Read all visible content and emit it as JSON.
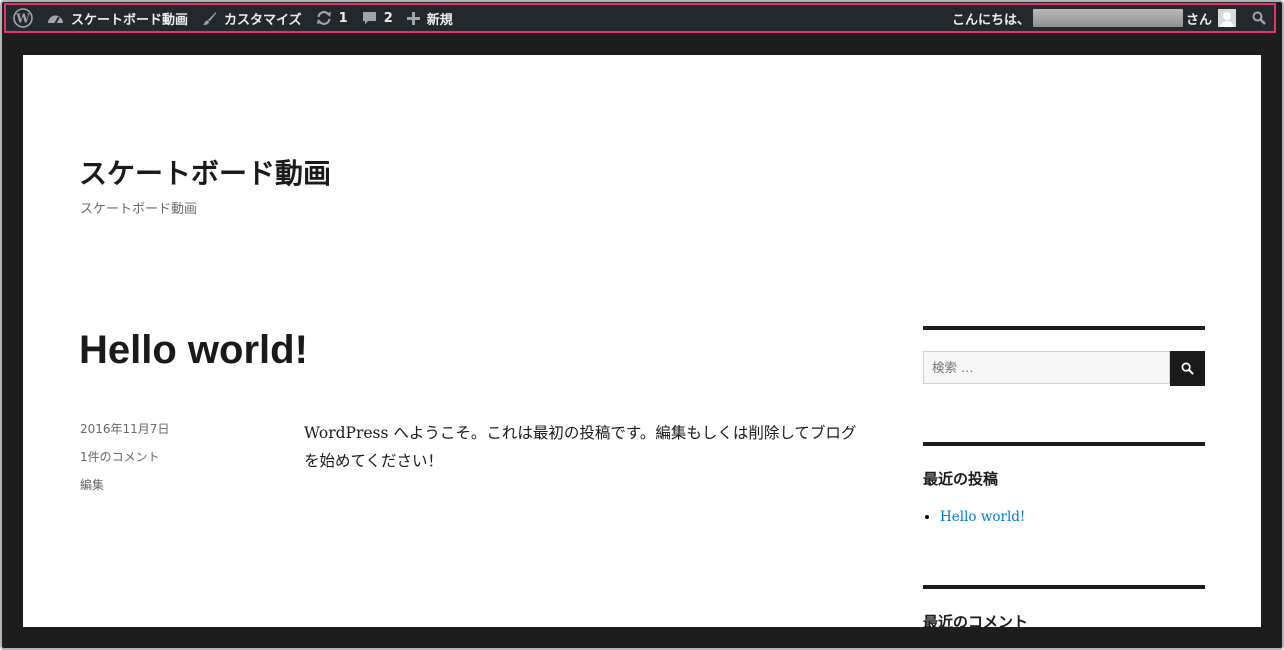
{
  "admin_bar": {
    "site_name": "スケートボード動画",
    "customize": "カスタマイズ",
    "updates_count": "1",
    "comments_count": "2",
    "new_label": "新規",
    "greeting": "こんにちは、",
    "honorific": "さん"
  },
  "site": {
    "title": "スケートボード動画",
    "description": "スケートボード動画"
  },
  "post": {
    "title": "Hello world!",
    "date": "2016年11月7日",
    "comments": "1件のコメント",
    "edit": "編集",
    "body": "WordPress へようこそ。これは最初の投稿です。編集もしくは削除してブログを始めてください！"
  },
  "sidebar": {
    "search_placeholder": "検索 …",
    "recent_posts_title": "最近の投稿",
    "recent_posts": [
      "Hello world!"
    ],
    "recent_comments_title": "最近のコメント"
  },
  "colors": {
    "admin_bar_bg": "#23282d",
    "highlight_border": "#e0356e",
    "link": "#007acc"
  }
}
